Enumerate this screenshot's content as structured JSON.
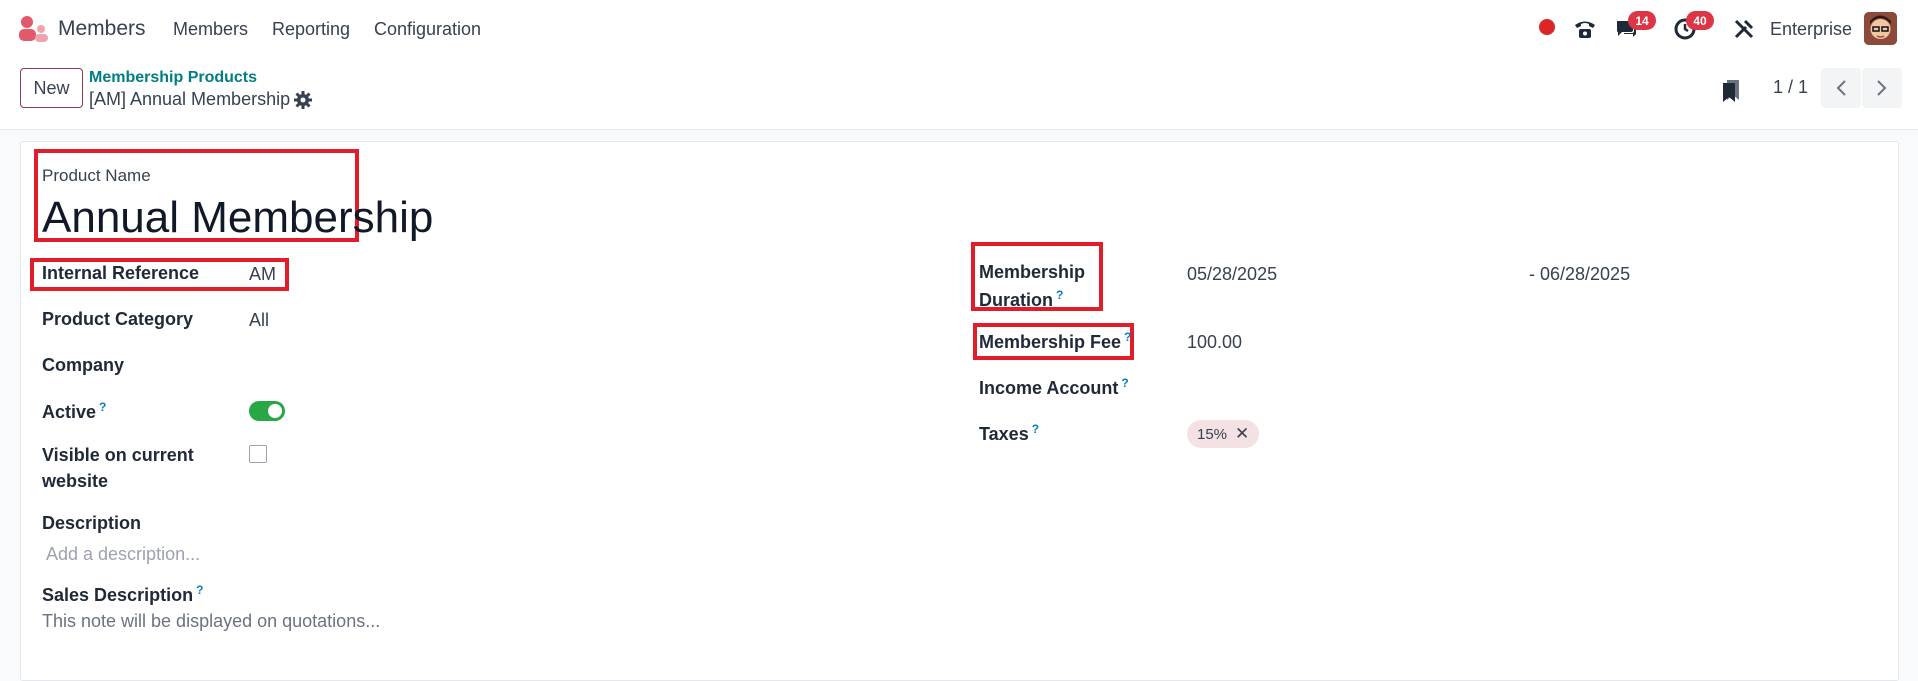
{
  "topbar": {
    "app_name": "Members",
    "menu": [
      "Members",
      "Reporting",
      "Configuration"
    ],
    "chat_badge": "14",
    "activity_badge": "40",
    "company": "Enterprise"
  },
  "control": {
    "new_label": "New",
    "breadcrumb_parent": "Membership Products",
    "breadcrumb_current": "[AM] Annual Membership",
    "pager": "1 / 1"
  },
  "form": {
    "product_name_label": "Product Name",
    "product_name": "Annual Membership",
    "internal_reference_label": "Internal Reference",
    "internal_reference": "AM",
    "product_category_label": "Product Category",
    "product_category": "All",
    "company_label": "Company",
    "active_label": "Active",
    "active_help": "?",
    "active": true,
    "visible_label_line1": "Visible on current",
    "visible_label_line2": "website",
    "visible": false,
    "description_label": "Description",
    "description_placeholder": "Add a description...",
    "sales_description_label": "Sales Description",
    "sales_description_help": "?",
    "sales_description_placeholder": "This note will be displayed on quotations...",
    "membership_duration_label_line1": "Membership",
    "membership_duration_label_line2": "Duration",
    "membership_duration_help": "?",
    "date_from": "05/28/2025",
    "date_to": "- 06/28/2025",
    "membership_fee_label": "Membership Fee",
    "membership_fee_help": "?",
    "membership_fee": "100.00",
    "income_account_label": "Income Account",
    "income_account_help": "?",
    "taxes_label": "Taxes",
    "taxes_help": "?",
    "tax_tag": "15%"
  },
  "colors": {
    "highlight": "#e11d2a",
    "link": "#017e84",
    "toggle_on": "#28a745",
    "badge": "#dc3545"
  }
}
